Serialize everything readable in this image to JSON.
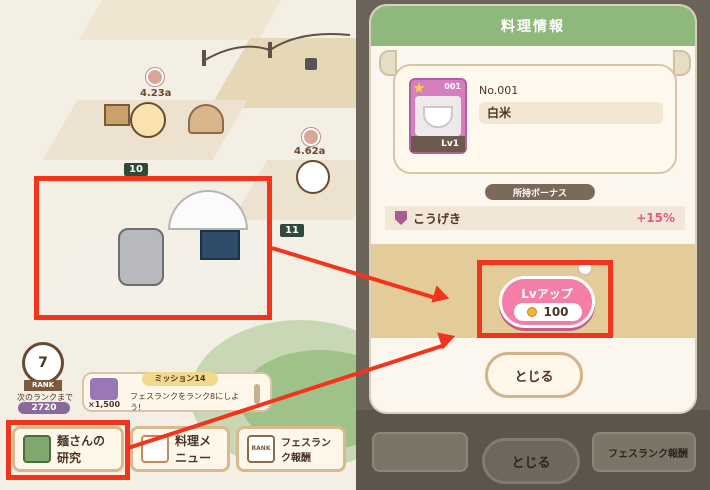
{
  "map": {
    "stall_a_rate": "4.23a",
    "stall_b_rate": "4.62a",
    "tag_10": "10",
    "tag_11": "11"
  },
  "rank": {
    "label": "RANK",
    "level": "7",
    "next_caption": "次のランクまで",
    "next_value": "2720"
  },
  "mission": {
    "title": "ミッション14",
    "reward": "×1,500",
    "text": "フェスランクをランク8にしよう!"
  },
  "bottom_bar": {
    "research_label": "麺さんの研究",
    "menu_label": "料理メニュー",
    "fes_rank_label": "フェスランク報酬",
    "fes_rank_icon_text": "RANK"
  },
  "dialog": {
    "title": "料理情報",
    "item_number": "No.001",
    "item_name": "白米",
    "item_id": "001",
    "item_level": "Lv1",
    "bonus_header": "所持ボーナス",
    "bonus_stat": "こうげき",
    "bonus_value": "+15%",
    "levelup_label": "Lvアップ",
    "levelup_cost": "100",
    "close_label": "とじる"
  },
  "bg_bar": {
    "close_label": "とじる",
    "fes_rank_label": "フェスランク報酬"
  },
  "colors": {
    "highlight": "#f2341d",
    "header": "#8fb97c",
    "levelup": "#f47ea8",
    "bonus_value": "#e75a7c"
  }
}
